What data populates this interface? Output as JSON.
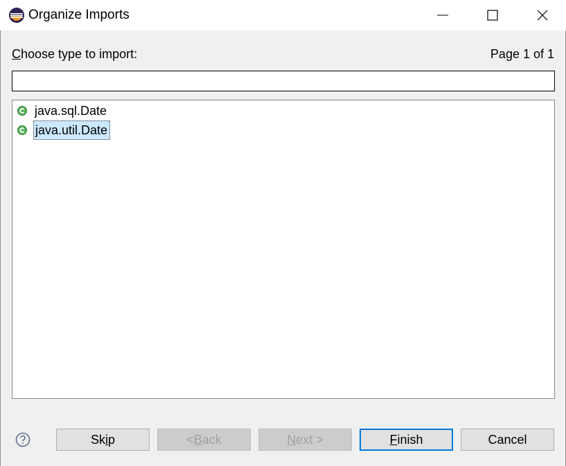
{
  "window": {
    "title": "Organize Imports",
    "app_icon": "eclipse-icon"
  },
  "prompt": {
    "label_accel": "C",
    "label_rest": "hoose type to import:",
    "page_indicator": "Page 1 of 1"
  },
  "filter": {
    "value": "",
    "placeholder": ""
  },
  "types": [
    {
      "name": "java.sql.Date",
      "icon": "class-icon",
      "selected": false
    },
    {
      "name": "java.util.Date",
      "icon": "class-icon",
      "selected": true
    }
  ],
  "buttons": {
    "skip": {
      "before": "Sk",
      "accel": "i",
      "after": "p"
    },
    "back": {
      "before": "< ",
      "accel": "B",
      "after": "ack"
    },
    "next": {
      "before": "",
      "accel": "N",
      "after": "ext >"
    },
    "finish": {
      "before": "",
      "accel": "F",
      "after": "inish"
    },
    "cancel": {
      "label": "Cancel"
    }
  },
  "colors": {
    "selection": "#cce8ff",
    "class_icon": "#3c8a3c",
    "default_button_border": "#0078d7"
  }
}
